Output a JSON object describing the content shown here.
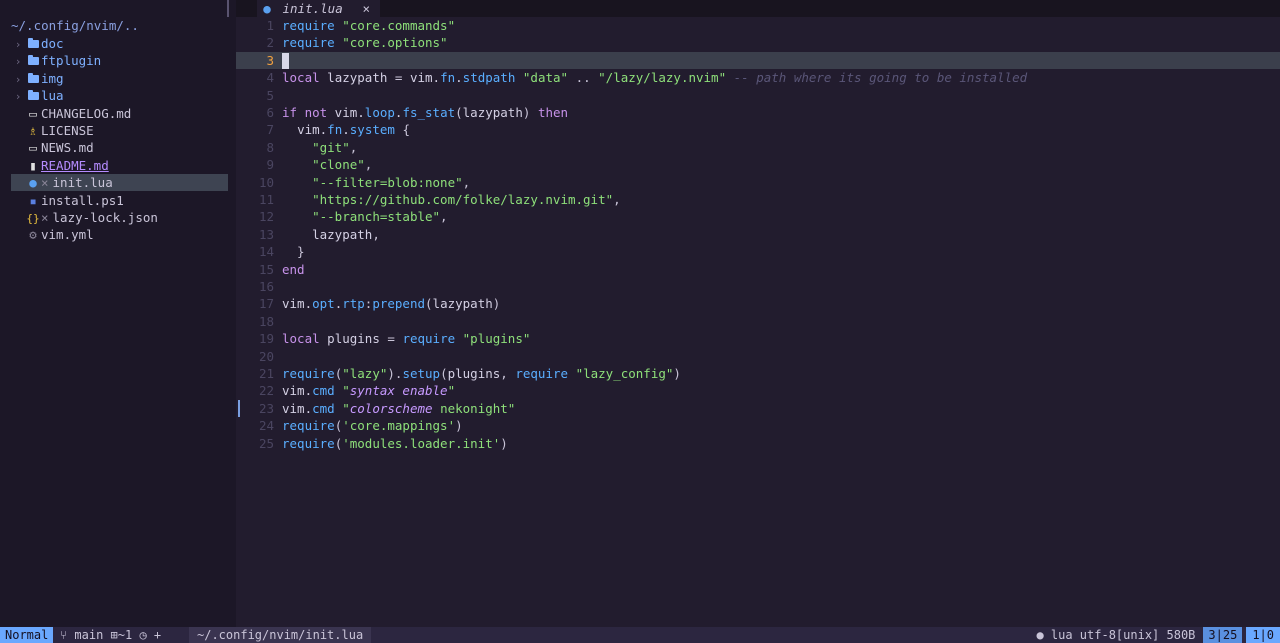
{
  "tab": {
    "name": "init.lua",
    "close": "×",
    "icon": "lua-icon"
  },
  "explorer": {
    "root": "~/.config/nvim/..",
    "items": [
      {
        "name": "doc",
        "type": "folder",
        "icon": "folder-icon",
        "chev": "›"
      },
      {
        "name": "ftplugin",
        "type": "folder",
        "icon": "folder-icon",
        "chev": "›"
      },
      {
        "name": "img",
        "type": "folder",
        "icon": "folder-icon",
        "chev": "›"
      },
      {
        "name": "lua",
        "type": "folder",
        "icon": "folder-icon",
        "chev": "›"
      },
      {
        "name": "CHANGELOG.md",
        "type": "file",
        "icon": "markdown-icon",
        "glyph": "▭"
      },
      {
        "name": "LICENSE",
        "type": "file",
        "icon": "license-icon",
        "glyph": "♗"
      },
      {
        "name": "NEWS.md",
        "type": "file",
        "icon": "markdown-icon",
        "glyph": "▭"
      },
      {
        "name": "README.md",
        "type": "file",
        "icon": "readme-icon",
        "glyph": "▮"
      },
      {
        "name": "init.lua",
        "type": "file",
        "icon": "lua-icon",
        "glyph": "●",
        "mod": "×"
      },
      {
        "name": "install.ps1",
        "type": "file",
        "icon": "powershell-icon",
        "glyph": "▪"
      },
      {
        "name": "lazy-lock.json",
        "type": "file",
        "icon": "json-icon",
        "glyph": "{}",
        "mod": "×"
      },
      {
        "name": "vim.yml",
        "type": "file",
        "icon": "gear-icon",
        "glyph": "⚙"
      }
    ]
  },
  "editor": {
    "current_line": 3,
    "lines": [
      [
        [
          "fn",
          "require"
        ],
        [
          "pu",
          " "
        ],
        [
          "st",
          "\"core.commands\""
        ]
      ],
      [
        [
          "fn",
          "require"
        ],
        [
          "pu",
          " "
        ],
        [
          "st",
          "\"core.options\""
        ]
      ],
      [],
      [
        [
          "kw",
          "local"
        ],
        [
          "id",
          " lazypath "
        ],
        [
          "pu",
          "= "
        ],
        [
          "id",
          "vim."
        ],
        [
          "fn",
          "fn"
        ],
        [
          "id",
          "."
        ],
        [
          "fn",
          "stdpath"
        ],
        [
          "pu",
          " "
        ],
        [
          "st",
          "\"data\""
        ],
        [
          "pu",
          " .. "
        ],
        [
          "st",
          "\"/lazy/lazy.nvim\""
        ],
        [
          "pu",
          " "
        ],
        [
          "cm",
          "-- path where its going to be installed"
        ]
      ],
      [],
      [
        [
          "kw",
          "if not"
        ],
        [
          "id",
          " vim."
        ],
        [
          "fn",
          "loop"
        ],
        [
          "id",
          "."
        ],
        [
          "fn",
          "fs_stat"
        ],
        [
          "pu",
          "("
        ],
        [
          "id",
          "lazypath"
        ],
        [
          "pu",
          ") "
        ],
        [
          "kw",
          "then"
        ]
      ],
      [
        [
          "pu",
          "  "
        ],
        [
          "id",
          "vim."
        ],
        [
          "fn",
          "fn"
        ],
        [
          "id",
          "."
        ],
        [
          "fn",
          "system"
        ],
        [
          "pu",
          " {"
        ]
      ],
      [
        [
          "pu",
          "    "
        ],
        [
          "st",
          "\"git\""
        ],
        [
          "pu",
          ","
        ]
      ],
      [
        [
          "pu",
          "    "
        ],
        [
          "st",
          "\"clone\""
        ],
        [
          "pu",
          ","
        ]
      ],
      [
        [
          "pu",
          "    "
        ],
        [
          "st",
          "\"--filter=blob:none\""
        ],
        [
          "pu",
          ","
        ]
      ],
      [
        [
          "pu",
          "    "
        ],
        [
          "st",
          "\"https://github.com/folke/lazy.nvim.git\""
        ],
        [
          "pu",
          ","
        ]
      ],
      [
        [
          "pu",
          "    "
        ],
        [
          "st",
          "\"--branch=stable\""
        ],
        [
          "pu",
          ","
        ]
      ],
      [
        [
          "pu",
          "    "
        ],
        [
          "id",
          "lazypath"
        ],
        [
          "pu",
          ","
        ]
      ],
      [
        [
          "pu",
          "  }"
        ]
      ],
      [
        [
          "kw",
          "end"
        ]
      ],
      [],
      [
        [
          "id",
          "vim."
        ],
        [
          "fn",
          "opt"
        ],
        [
          "id",
          "."
        ],
        [
          "fn",
          "rtp"
        ],
        [
          "pu",
          ":"
        ],
        [
          "fn",
          "prepend"
        ],
        [
          "pu",
          "("
        ],
        [
          "id",
          "lazypath"
        ],
        [
          "pu",
          ")"
        ]
      ],
      [],
      [
        [
          "kw",
          "local"
        ],
        [
          "id",
          " plugins "
        ],
        [
          "pu",
          "= "
        ],
        [
          "fn",
          "require"
        ],
        [
          "pu",
          " "
        ],
        [
          "st",
          "\"plugins\""
        ]
      ],
      [],
      [
        [
          "fn",
          "require"
        ],
        [
          "pu",
          "("
        ],
        [
          "st",
          "\"lazy\""
        ],
        [
          "pu",
          ")."
        ],
        [
          "fn",
          "setup"
        ],
        [
          "pu",
          "("
        ],
        [
          "id",
          "plugins"
        ],
        [
          "pu",
          ", "
        ],
        [
          "fn",
          "require"
        ],
        [
          "pu",
          " "
        ],
        [
          "st",
          "\"lazy_config\""
        ],
        [
          "pu",
          ")"
        ]
      ],
      [
        [
          "id",
          "vim."
        ],
        [
          "fn",
          "cmd"
        ],
        [
          "pu",
          " "
        ],
        [
          "st",
          "\""
        ],
        [
          "sti",
          "syntax enable"
        ],
        [
          "st",
          "\""
        ]
      ],
      [
        [
          "id",
          "vim."
        ],
        [
          "fn",
          "cmd"
        ],
        [
          "pu",
          " "
        ],
        [
          "st",
          "\""
        ],
        [
          "sti",
          "colorscheme"
        ],
        [
          "st",
          " nekonight\""
        ]
      ],
      [
        [
          "fn",
          "require"
        ],
        [
          "pu",
          "("
        ],
        [
          "st",
          "'core.mappings'"
        ],
        [
          "pu",
          ")"
        ]
      ],
      [
        [
          "fn",
          "require"
        ],
        [
          "pu",
          "("
        ],
        [
          "st",
          "'modules.loader.init'"
        ],
        [
          "pu",
          ")"
        ]
      ]
    ]
  },
  "statusbar": {
    "mode": "Normal",
    "git": "⑂ main ⊞~1 ◷ +",
    "filepath": "~/.config/nvim/init.lua",
    "filetype": "● lua utf-8[unix] 580B",
    "position": "3|25",
    "column": "1|0"
  }
}
